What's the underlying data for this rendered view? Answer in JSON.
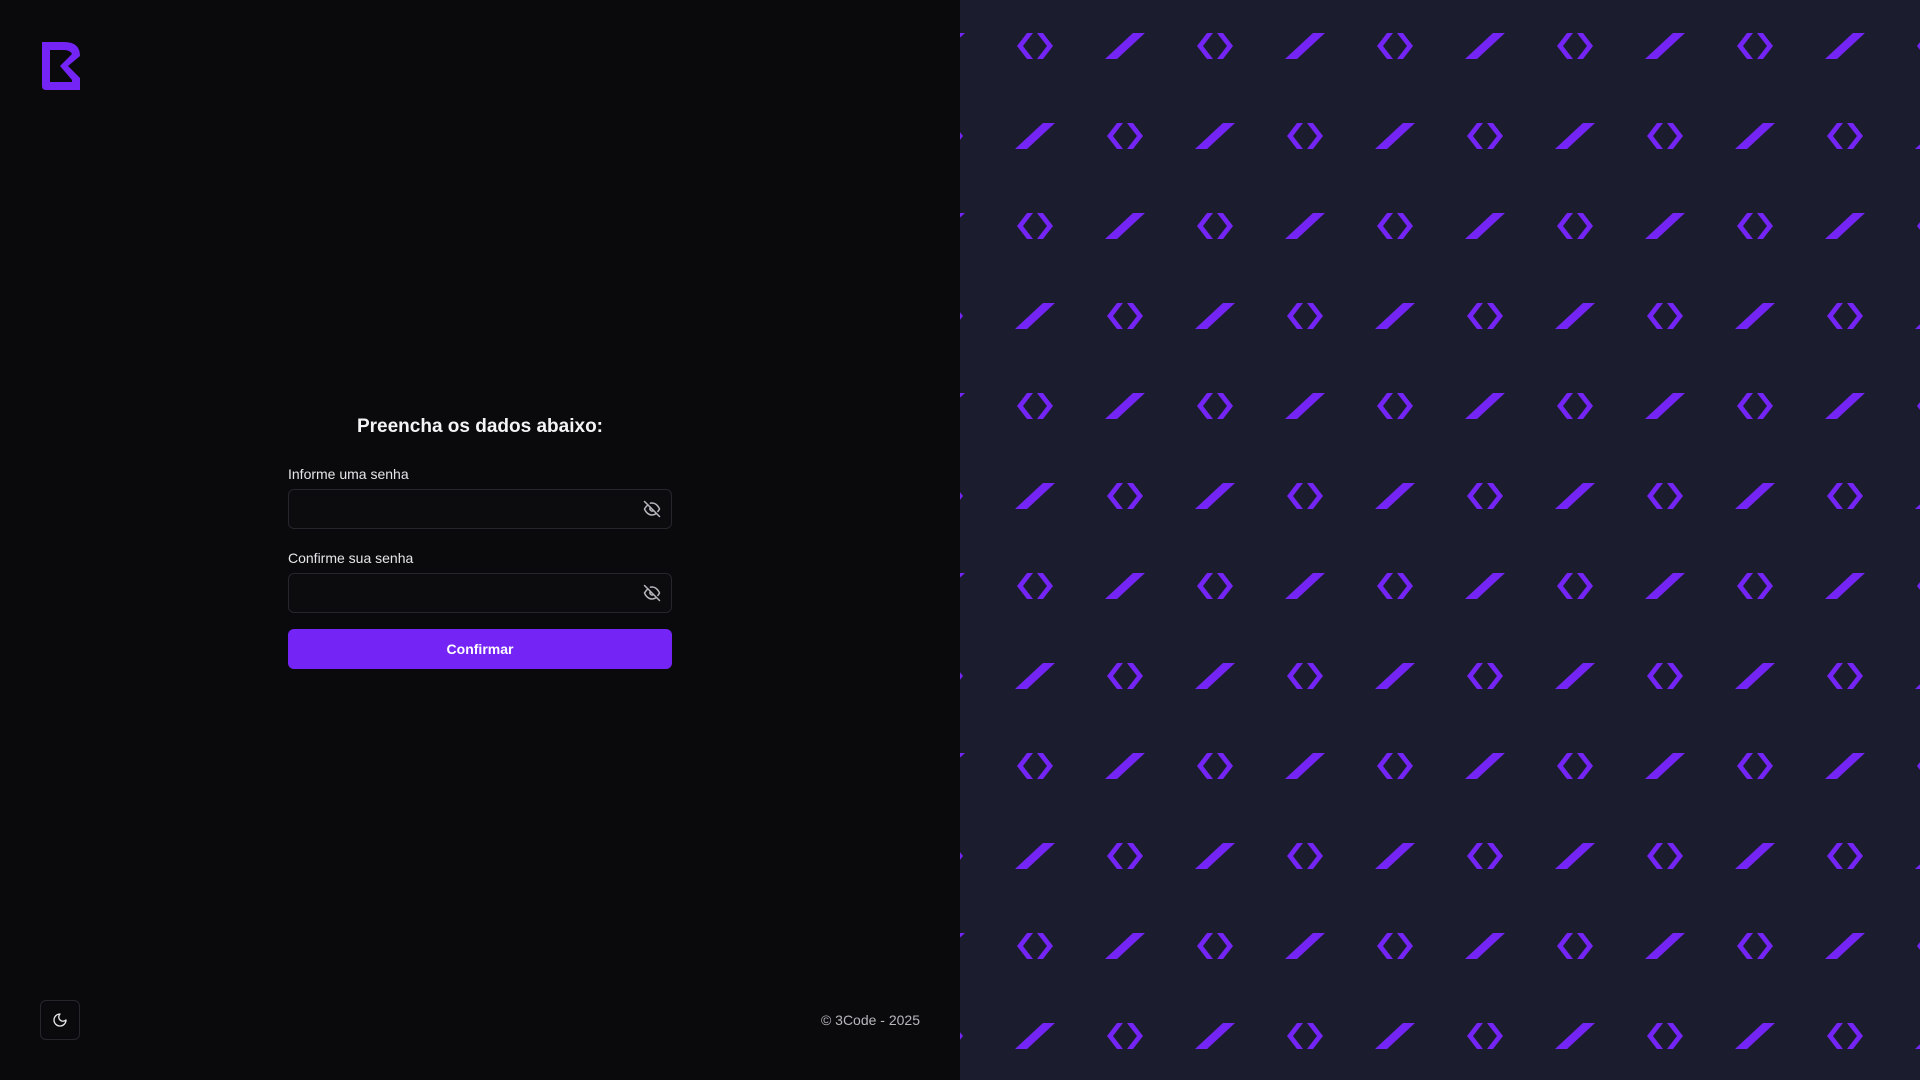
{
  "brand": {
    "logo_icon": "3code-logo-icon",
    "accent_color": "#7424f4",
    "pattern_background": "#1b1d2e"
  },
  "form": {
    "title": "Preencha os dados abaixo:",
    "password_label": "Informe uma senha",
    "password_value": "",
    "password_toggle_icon": "eye-off-icon",
    "confirm_label": "Confirme sua senha",
    "confirm_value": "",
    "confirm_toggle_icon": "eye-off-icon",
    "submit_label": "Confirmar"
  },
  "theme_toggle": {
    "icon": "moon-icon"
  },
  "footer": {
    "copyright": "© 3Code - 2025"
  }
}
